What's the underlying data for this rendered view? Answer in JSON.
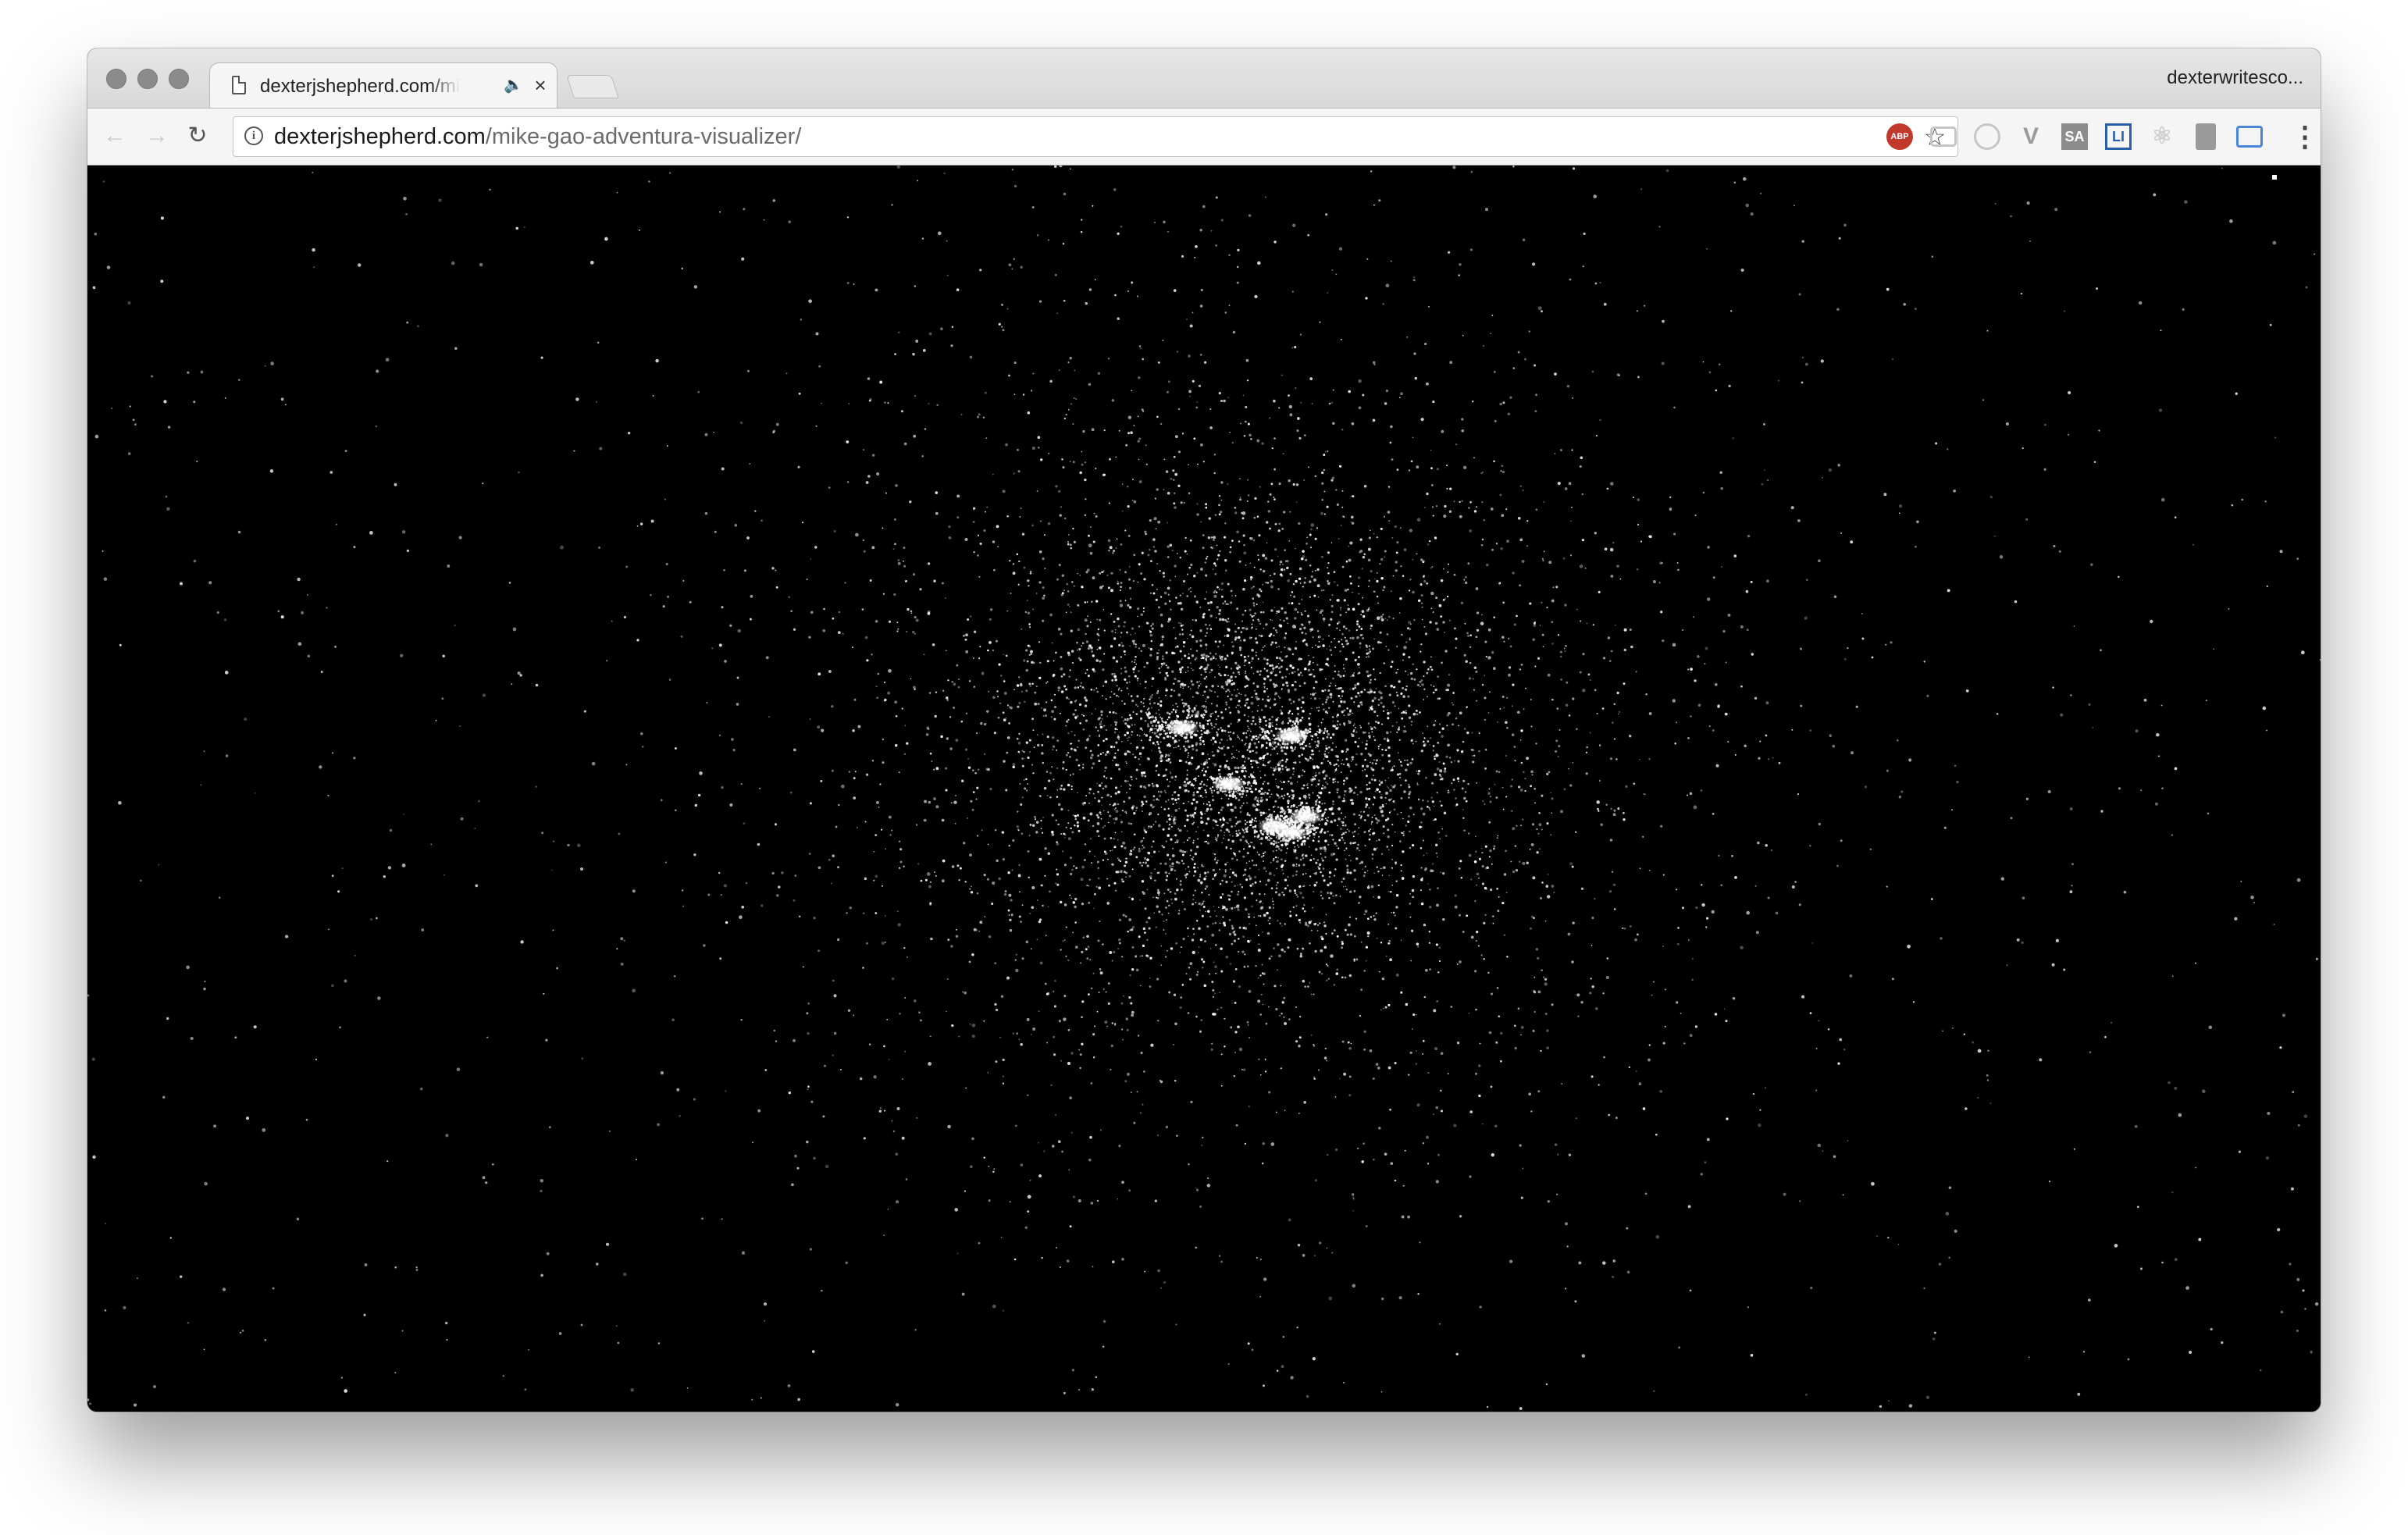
{
  "browser": {
    "tab": {
      "title": "dexterjshepherd.com/mike-gao-adventura-visualizer/",
      "audio_icon": "speaker-icon",
      "close_icon": "close-icon"
    },
    "profile_name": "dexterwritesco...",
    "toolbar": {
      "url_host": "dexterjshepherd.com",
      "url_path": "/mike-gao-adventura-visualizer/",
      "back_icon": "back-arrow-icon",
      "forward_icon": "forward-arrow-icon",
      "reload_icon": "reload-icon",
      "bookmark_icon": "star-icon",
      "menu_icon": "kebab-menu-icon",
      "extensions": [
        {
          "name": "adblock-plus-icon",
          "label": "ABP"
        },
        {
          "name": "chat-extension-icon",
          "label": ""
        },
        {
          "name": "circle-extension-icon",
          "label": ""
        },
        {
          "name": "vue-devtools-icon",
          "label": "V"
        },
        {
          "name": "sa-extension-icon",
          "label": "SA"
        },
        {
          "name": "li-extension-icon",
          "label": "LI"
        },
        {
          "name": "react-devtools-icon",
          "label": "⚛"
        },
        {
          "name": "page-extension-icon",
          "label": ""
        },
        {
          "name": "cast-icon",
          "label": ""
        }
      ]
    }
  },
  "page": {
    "background_color": "#000000",
    "particle_color": "#ffffff",
    "visual": "particle-cloud-visualizer"
  }
}
